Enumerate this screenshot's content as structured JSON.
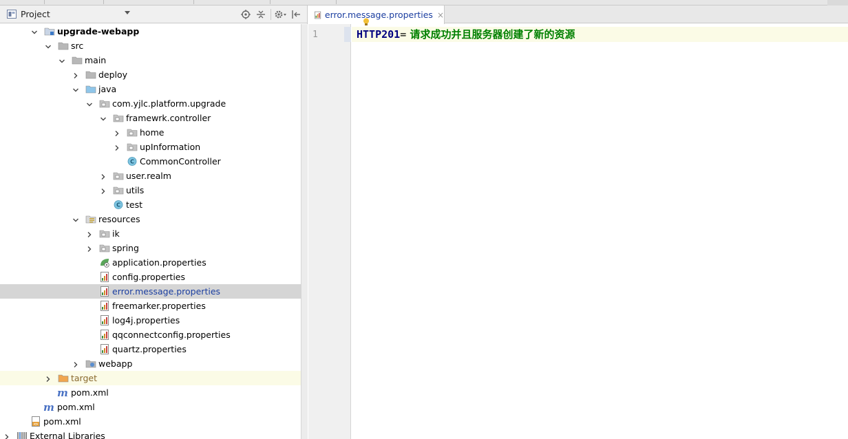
{
  "panel": {
    "title": "Project"
  },
  "tree": [
    {
      "label": "upgrade-webapp",
      "depth": 2,
      "arrow": "down",
      "icon": "module",
      "bold": true
    },
    {
      "label": "src",
      "depth": 3,
      "arrow": "down",
      "icon": "folder"
    },
    {
      "label": "main",
      "depth": 4,
      "arrow": "down",
      "icon": "folder"
    },
    {
      "label": "deploy",
      "depth": 5,
      "arrow": "right",
      "icon": "folder"
    },
    {
      "label": "java",
      "depth": 5,
      "arrow": "down",
      "icon": "folder-source"
    },
    {
      "label": "com.yjlc.platform.upgrade",
      "depth": 6,
      "arrow": "down",
      "icon": "package"
    },
    {
      "label": "framewrk.controller",
      "depth": 7,
      "arrow": "down",
      "icon": "package"
    },
    {
      "label": "home",
      "depth": 8,
      "arrow": "right",
      "icon": "package"
    },
    {
      "label": "upInformation",
      "depth": 8,
      "arrow": "right",
      "icon": "package"
    },
    {
      "label": "CommonController",
      "depth": 8,
      "arrow": "none",
      "icon": "class"
    },
    {
      "label": "user.realm",
      "depth": 7,
      "arrow": "right",
      "icon": "package"
    },
    {
      "label": "utils",
      "depth": 7,
      "arrow": "right",
      "icon": "package"
    },
    {
      "label": "test",
      "depth": 7,
      "arrow": "none",
      "icon": "class"
    },
    {
      "label": "resources",
      "depth": 5,
      "arrow": "down",
      "icon": "folder-resources"
    },
    {
      "label": "ik",
      "depth": 6,
      "arrow": "right",
      "icon": "package"
    },
    {
      "label": "spring",
      "depth": 6,
      "arrow": "right",
      "icon": "package"
    },
    {
      "label": "application.properties",
      "depth": 6,
      "arrow": "none",
      "icon": "spring-properties"
    },
    {
      "label": "config.properties",
      "depth": 6,
      "arrow": "none",
      "icon": "properties"
    },
    {
      "label": "error.message.properties",
      "depth": 6,
      "arrow": "none",
      "icon": "properties",
      "selected": true
    },
    {
      "label": "freemarker.properties",
      "depth": 6,
      "arrow": "none",
      "icon": "properties"
    },
    {
      "label": "log4j.properties",
      "depth": 6,
      "arrow": "none",
      "icon": "properties"
    },
    {
      "label": "qqconnectconfig.properties",
      "depth": 6,
      "arrow": "none",
      "icon": "properties"
    },
    {
      "label": "quartz.properties",
      "depth": 6,
      "arrow": "none",
      "icon": "properties"
    },
    {
      "label": "webapp",
      "depth": 5,
      "arrow": "right",
      "icon": "folder-web"
    },
    {
      "label": "target",
      "depth": 3,
      "arrow": "right",
      "icon": "folder-excluded",
      "highlighted": true
    },
    {
      "label": "pom.xml",
      "depth": 3,
      "arrow": "none",
      "icon": "maven"
    },
    {
      "label": "pom.xml",
      "depth": 2,
      "arrow": "none",
      "icon": "maven"
    },
    {
      "label": "pom.xml",
      "depth": 1,
      "arrow": "none",
      "icon": "xml"
    },
    {
      "label": "External Libraries",
      "depth": 0,
      "arrow": "right",
      "icon": "libraries"
    }
  ],
  "editor": {
    "tab_label": "error.message.properties",
    "close_glyph": "×",
    "line_number": "1",
    "code_key": "HTTP201",
    "code_eq": "=",
    "code_value": " 请求成功并且服务器创建了新的资源"
  }
}
